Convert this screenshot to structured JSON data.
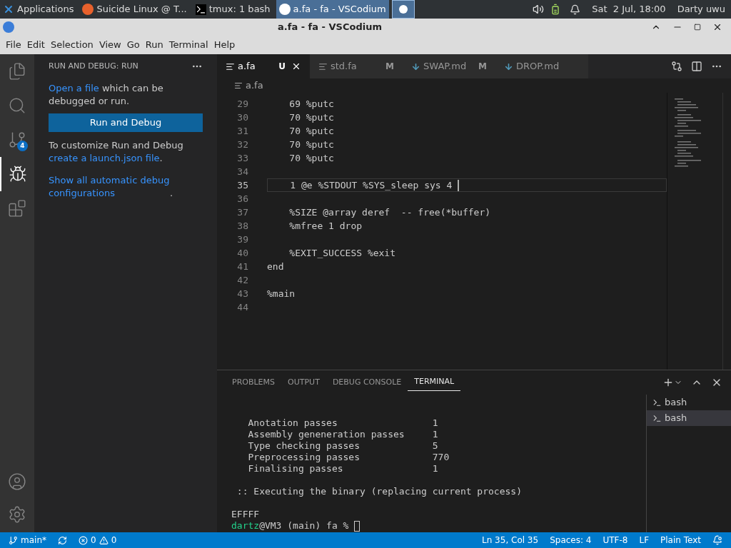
{
  "taskbar": {
    "items": [
      {
        "kind": "menu",
        "label": "Applications",
        "selected": false
      },
      {
        "kind": "browser",
        "label": "Suicide Linux @ T...",
        "selected": false
      },
      {
        "kind": "terminal",
        "label": "tmux: 1 bash",
        "selected": false
      },
      {
        "kind": "editor",
        "label": "a.fa - fa - VSCodium",
        "selected": true
      },
      {
        "kind": "workspace",
        "selected": true
      }
    ],
    "clock": "Sat  2 Jul, 18:00",
    "user": "Darty uwu"
  },
  "window": {
    "title": "a.fa - fa - VSCodium"
  },
  "menu": [
    "File",
    "Edit",
    "Selection",
    "View",
    "Go",
    "Run",
    "Terminal",
    "Help"
  ],
  "activity_bar": {
    "items": [
      {
        "kind": "files",
        "selected": false
      },
      {
        "kind": "search",
        "selected": false
      },
      {
        "kind": "scm",
        "selected": false,
        "badge": "4"
      },
      {
        "kind": "debug",
        "selected": true
      },
      {
        "kind": "extensions",
        "selected": false
      }
    ]
  },
  "sidebar": {
    "title": "RUN AND DEBUG: RUN",
    "open_link": "Open a file",
    "open_text": "which can be debugged or run.",
    "button": "Run and Debug",
    "customize_text": "To customize Run and Debug",
    "launch_link": "create a launch.json file",
    "show_link": "Show all automatic debug configurations",
    "period": "."
  },
  "tabs": [
    {
      "kind": "source",
      "label": "a.fa",
      "status": "U",
      "selected": true
    },
    {
      "kind": "source",
      "label": "std.fa",
      "status": "M",
      "selected": false
    },
    {
      "kind": "markdown",
      "label": "SWAP.md",
      "status": "M",
      "selected": false
    },
    {
      "kind": "markdown",
      "label": "DROP.md",
      "selected": false
    }
  ],
  "breadcrumb": "a.fa",
  "code": [
    {
      "n": "29",
      "text": "    69 %putc",
      "current": false
    },
    {
      "n": "30",
      "text": "    70 %putc",
      "current": false
    },
    {
      "n": "31",
      "text": "    70 %putc",
      "current": false
    },
    {
      "n": "32",
      "text": "    70 %putc",
      "current": false
    },
    {
      "n": "33",
      "text": "    70 %putc",
      "current": false
    },
    {
      "n": "34",
      "current": false
    },
    {
      "n": "35",
      "text": "    1 @e %STDOUT %SYS_sleep sys 4 ",
      "current": true
    },
    {
      "n": "36",
      "current": false
    },
    {
      "n": "37",
      "text": "    %SIZE @array deref  -- free(*buffer)",
      "current": false
    },
    {
      "n": "38",
      "text": "    %mfree 1 drop",
      "current": false
    },
    {
      "n": "39",
      "current": false
    },
    {
      "n": "40",
      "text": "    %EXIT_SUCCESS %exit",
      "current": false
    },
    {
      "n": "41",
      "text": "end",
      "current": false
    },
    {
      "n": "42",
      "current": false
    },
    {
      "n": "43",
      "text": "%main",
      "current": false
    },
    {
      "n": "44",
      "current": false
    }
  ],
  "panel": {
    "tabs": [
      {
        "label": "PROBLEMS",
        "selected": false
      },
      {
        "label": "OUTPUT",
        "selected": false
      },
      {
        "label": "DEBUG CONSOLE",
        "selected": false
      },
      {
        "label": "TERMINAL",
        "selected": true
      }
    ],
    "terminal_lines": [
      {
        "kind": "blank"
      },
      {
        "kind": "blank"
      },
      {
        "kind": "text",
        "text": "   Anotation passes                 1"
      },
      {
        "kind": "text",
        "text": "   Assembly geneneration passes     1"
      },
      {
        "kind": "text",
        "text": "   Type checking passes             5"
      },
      {
        "kind": "text",
        "text": "   Preprocessing passes             770"
      },
      {
        "kind": "text",
        "text": "   Finalising passes                1"
      },
      {
        "kind": "blank"
      },
      {
        "kind": "text",
        "text": " :: Executing the binary (replacing current process)"
      },
      {
        "kind": "blank"
      },
      {
        "kind": "text",
        "text": "EFFFF"
      }
    ],
    "prompt": {
      "user": "dartz",
      "rest": "@VM3 (main) fa % "
    },
    "terminals": [
      {
        "label": "bash",
        "selected": false
      },
      {
        "label": "bash",
        "selected": true
      }
    ]
  },
  "status_bar": {
    "branch": "main*",
    "errors": "0",
    "warnings": "0",
    "right": [
      "Ln 35, Col 35",
      "Spaces: 4",
      "UTF-8",
      "LF",
      "Plain Text"
    ]
  }
}
